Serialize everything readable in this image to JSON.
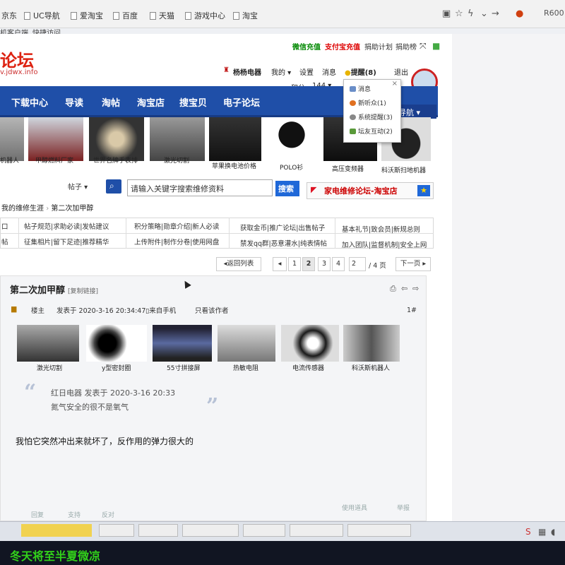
{
  "browser": {
    "bookmarks": [
      "京东",
      "UC导航",
      "爱淘宝",
      "百度",
      "天猫",
      "游戏中心",
      "淘宝"
    ],
    "second_row": [
      "机客户端",
      "快捷访问"
    ],
    "right_label": "R600"
  },
  "site": {
    "top_links": [
      "微信充值",
      "支付宝充值",
      "捐助计划",
      "捐助榜"
    ],
    "logo": "论坛",
    "logo_sub": "v.jdwx.info",
    "user": {
      "name": "杨杨电器",
      "mine": "我的",
      "settings": "设置",
      "messages": "消息",
      "reminder": "提醒",
      "reminder_count": "(8)",
      "logout": "退出",
      "points_label": "积分:",
      "points": "144"
    },
    "nav": [
      "下载中心",
      "导读",
      "淘帖",
      "淘宝店",
      "搜宝贝",
      "电子论坛"
    ],
    "nav_right": "导航",
    "dropdown": [
      {
        "label": "消息",
        "count": ""
      },
      {
        "label": "新听众",
        "count": "(1)"
      },
      {
        "label": "系统提醒",
        "count": "(3)"
      },
      {
        "label": "坛友互动",
        "count": "(2)"
      }
    ],
    "thumb_captions": [
      "机器人",
      "甲醇燃料厂家",
      "世界名牌手表排",
      "激光切割",
      "苹果换电池价格",
      "POLO衫",
      "高压变频器",
      "科沃斯扫地机器"
    ],
    "search": {
      "type": "帖子",
      "placeholder": "请输入关键字搜索维修资料",
      "button": "搜索",
      "shop": "家电维修论坛-淘宝店"
    },
    "breadcrumb": [
      "我的维修生涯",
      "第二次加甲醇"
    ],
    "links_grid": [
      [
        "口",
        "帖子规范|求助必读|发帖建议",
        "积分策略|勋章介绍|新人必读",
        "获取金币|推广论坛|出售帖子",
        "基本礼节|致会员|新规总则"
      ],
      [
        "帖",
        "征集相片|留下足迹|推荐精华",
        "上传附件|制作分卷|使用网盘",
        "禁发qq群|恶意灌水|纯表情帖",
        "加入团队|监督机制|安全上网"
      ]
    ],
    "pager": {
      "back": "返回列表",
      "pages": [
        "1",
        "2",
        "3",
        "4"
      ],
      "current": "2",
      "input": "2",
      "total": "/ 4 页",
      "next": "下一页"
    },
    "post": {
      "title": "第二次加甲醇",
      "copy_link": "[复制链接]",
      "author_role": "楼主",
      "posted": "发表于 2020-3-16 20:34:47",
      "from": "来自手机",
      "only_author": "只看该作者",
      "floor": "1#",
      "ads": [
        "激光切割",
        "y型密封圈",
        "55寸拼接屏",
        "热敏电阻",
        "电流传感器",
        "科沃斯机器人"
      ],
      "quote_author": "红日电器  发表于  2020-3-16 20:33",
      "quote_text": "氮气安全的很不是氧气",
      "body": "我怕它突然冲出来就坏了，反作用的弹力很大的",
      "footer": [
        "回复",
        "支持",
        "反对",
        "使用道具",
        "举报"
      ]
    },
    "watermark": "冬天将至半夏微凉"
  }
}
